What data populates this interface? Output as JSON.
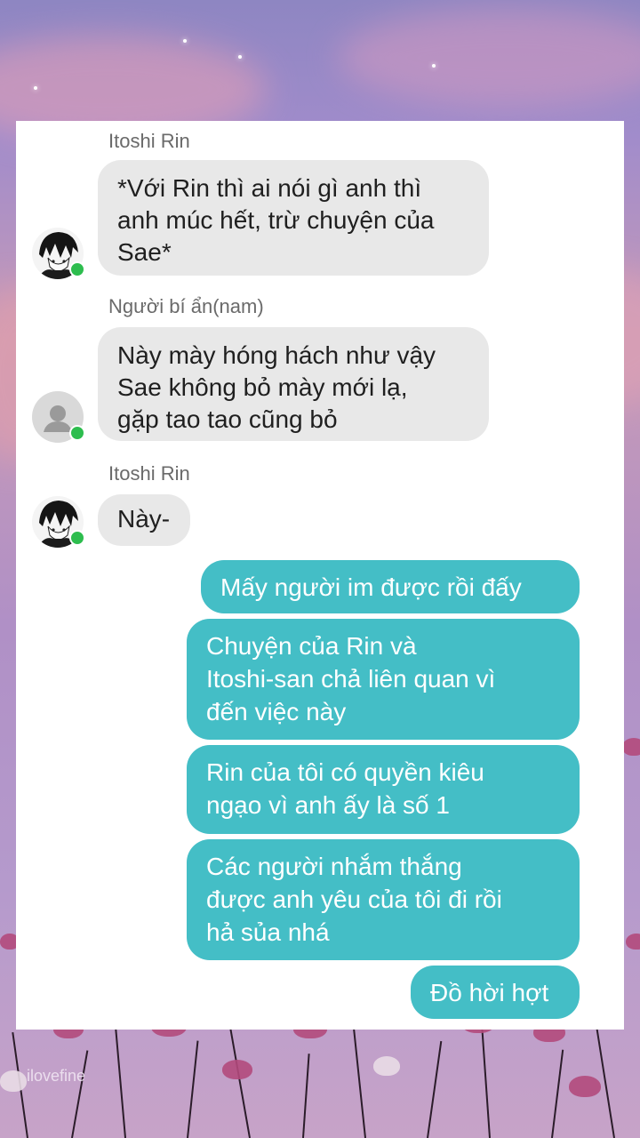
{
  "messages_in": [
    {
      "sender": "Itoshi Rin",
      "lines": [
        "*Với Rin thì ai nói gì anh thì",
        "anh múc hết, trừ chuyện của",
        "Sae*"
      ],
      "avatar": "anime-avatar-icon",
      "online": true
    },
    {
      "sender": "Người bí ẩn(nam)",
      "lines": [
        "Này mày hóng hách như vậy",
        "Sae không bỏ mày mới lạ,",
        "gặp tao tao cũng bỏ"
      ],
      "avatar": "default-user-icon",
      "online": true
    },
    {
      "sender": "Itoshi Rin",
      "lines": [
        "Này-"
      ],
      "avatar": "anime-avatar-icon",
      "online": true
    }
  ],
  "messages_out": [
    {
      "lines": [
        "Mấy người im được rồi đấy"
      ]
    },
    {
      "lines": [
        "Chuyện của Rin và",
        "Itoshi-san chả liên quan vì",
        "đến việc này"
      ]
    },
    {
      "lines": [
        "Rin của tôi có quyền kiêu",
        "ngạo vì anh ấy là số 1"
      ]
    },
    {
      "lines": [
        "Các người nhắm thắng",
        "được anh yêu của tôi đi rồi",
        "hả sủa nhá"
      ]
    },
    {
      "lines": [
        "Đồ hời hợt"
      ]
    }
  ],
  "watermark": "ilovefine",
  "colors": {
    "incoming_bubble": "#e8e8e8",
    "outgoing_bubble": "#44bec6",
    "online": "#2dbd4e"
  }
}
